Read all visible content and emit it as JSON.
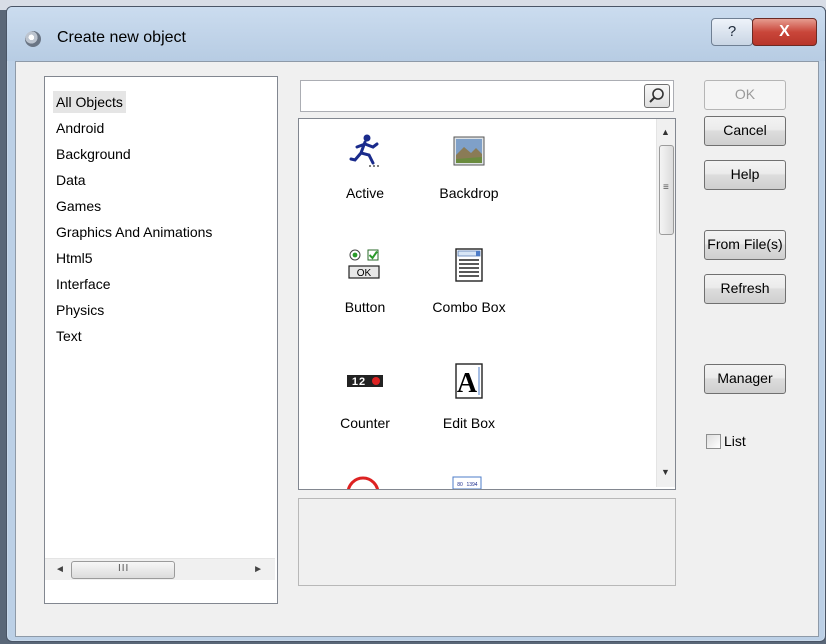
{
  "window": {
    "title": "Create new object",
    "help_glyph": "?",
    "close_glyph": "X"
  },
  "categories": [
    {
      "label": "All Objects",
      "selected": true
    },
    {
      "label": "Android"
    },
    {
      "label": "Background"
    },
    {
      "label": "Data"
    },
    {
      "label": "Games"
    },
    {
      "label": "Graphics And Animations"
    },
    {
      "label": "Html5"
    },
    {
      "label": "Interface"
    },
    {
      "label": "Physics"
    },
    {
      "label": "Text"
    }
  ],
  "category_scrollbar": {
    "grip": "III",
    "left_arrow": "◄",
    "right_arrow": "►"
  },
  "search": {
    "value": "",
    "placeholder": ""
  },
  "objects": [
    {
      "label": "Active",
      "icon": "running-man-icon"
    },
    {
      "label": "Backdrop",
      "icon": "landscape-picture-icon"
    },
    {
      "label": "Button",
      "icon": "button-controls-icon"
    },
    {
      "label": "Combo Box",
      "icon": "combo-box-icon"
    },
    {
      "label": "Counter",
      "icon": "counter-digits-icon"
    },
    {
      "label": "Edit Box",
      "icon": "edit-box-icon"
    }
  ],
  "object_icon_text": {
    "button_ok": "OK",
    "counter": "12",
    "editbox_letter": "A",
    "grid_cell_a": "80",
    "grid_cell_b": "1394"
  },
  "object_scrollbar": {
    "up_arrow": "▲",
    "down_arrow": "▼",
    "grip": "≡"
  },
  "buttons": {
    "ok": "OK",
    "cancel": "Cancel",
    "help": "Help",
    "from_files": "From File(s)",
    "refresh": "Refresh",
    "manager": "Manager"
  },
  "list_checkbox": {
    "label": "List",
    "checked": false
  }
}
